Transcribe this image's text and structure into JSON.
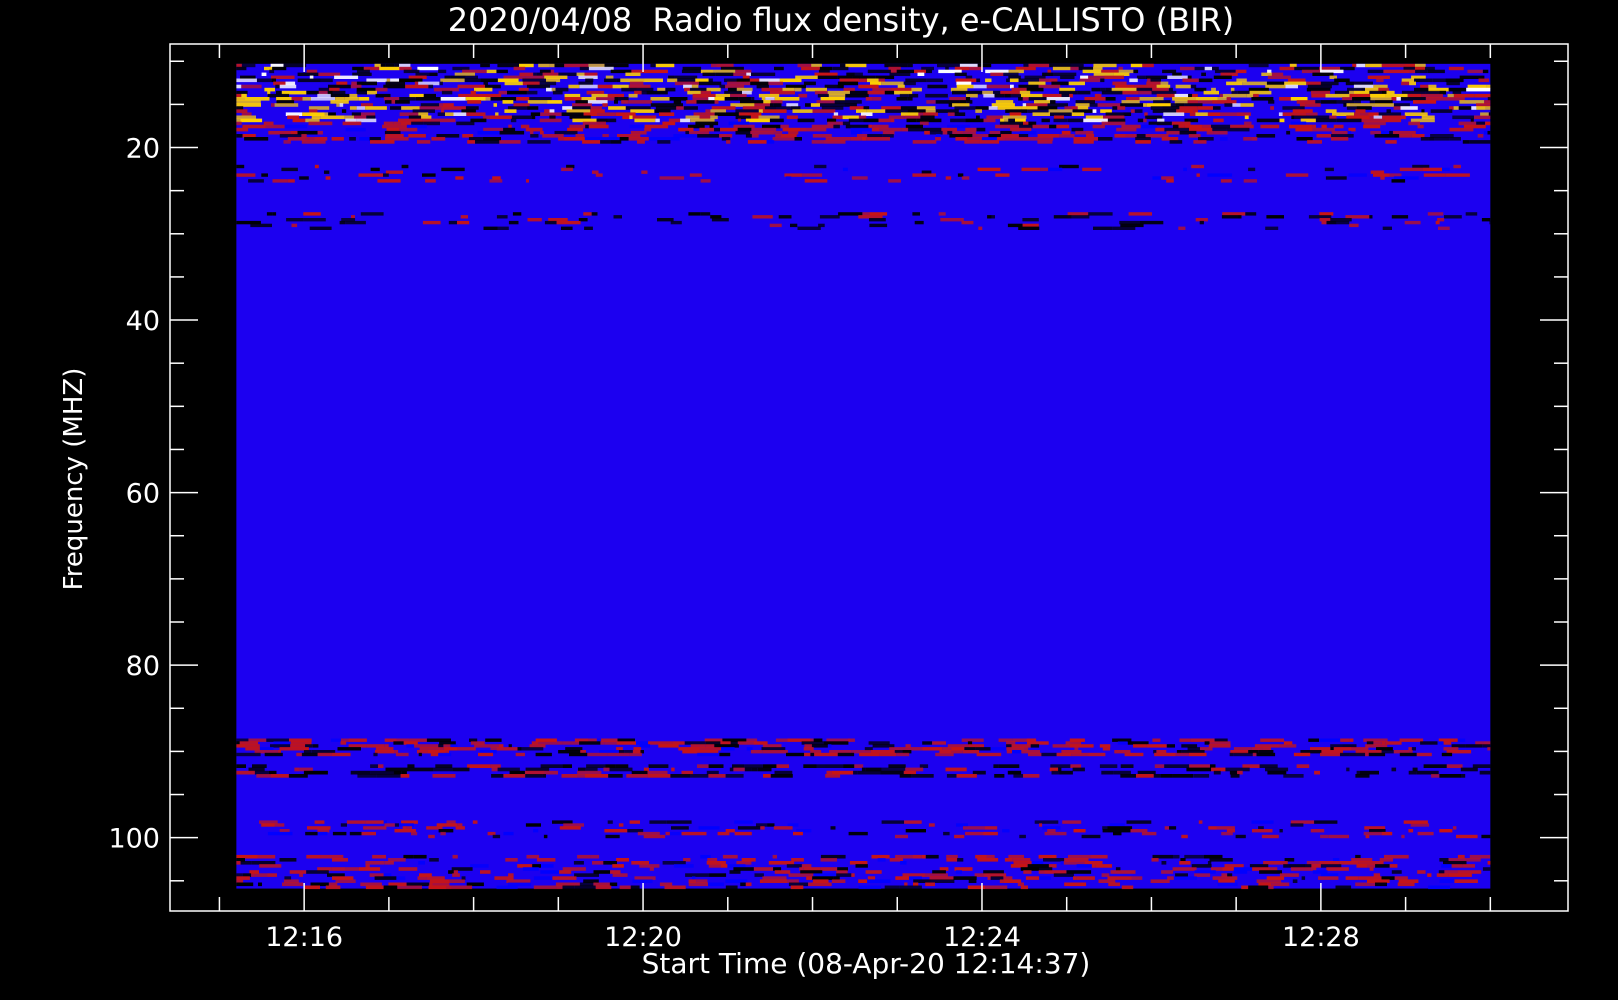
{
  "chart_data": {
    "type": "heatmap",
    "title": "2020/04/08  Radio flux density, e-CALLISTO (BIR)",
    "xlabel": "Start Time (08-Apr-20 12:14:37)",
    "ylabel": "Frequency (MHZ)",
    "x_axis": {
      "unit": "time",
      "range": [
        "12:14:25",
        "12:30:55"
      ],
      "data_range": [
        "12:15:12",
        "12:30:00"
      ],
      "major_ticks": [
        "12:16",
        "12:20",
        "12:24",
        "12:28"
      ],
      "minor_tick_step_minutes": 1
    },
    "y_axis": {
      "unit": "MHz",
      "inverted": true,
      "range": [
        8,
        108.5
      ],
      "data_range": [
        10.3,
        105.9
      ],
      "major_ticks": [
        20,
        40,
        60,
        80,
        100
      ],
      "minor_tick_step": 5
    },
    "colormap": "blue background with red-yellow-white emission",
    "colors": {
      "background": "#000000",
      "axes": "#ffffff",
      "baseline": "#1c00f0",
      "low": "#0000ff",
      "medium": "#c81414",
      "high": "#ffd000",
      "peak": "#ffffff",
      "dark": "#000000"
    },
    "bands": [
      {
        "freq": [
          10.3,
          12.0
        ],
        "intensity": "high",
        "coverage": 0.45
      },
      {
        "freq": [
          12.0,
          14.5
        ],
        "intensity": "high",
        "coverage": 0.6
      },
      {
        "freq": [
          14.5,
          17.0
        ],
        "intensity": "high",
        "coverage": 0.55
      },
      {
        "freq": [
          17.0,
          19.5
        ],
        "intensity": "medium",
        "coverage": 0.45
      },
      {
        "freq": [
          22.0,
          24.0
        ],
        "intensity": "medium",
        "coverage": 0.15
      },
      {
        "freq": [
          27.5,
          29.5
        ],
        "intensity": "dark",
        "coverage": 0.2
      },
      {
        "freq": [
          88.5,
          90.5
        ],
        "intensity": "medium",
        "coverage": 0.55
      },
      {
        "freq": [
          91.5,
          93.0
        ],
        "intensity": "dark",
        "coverage": 0.45
      },
      {
        "freq": [
          98.0,
          100.0
        ],
        "intensity": "medium",
        "coverage": 0.25
      },
      {
        "freq": [
          102.0,
          105.9
        ],
        "intensity": "medium",
        "coverage": 0.35
      }
    ]
  }
}
